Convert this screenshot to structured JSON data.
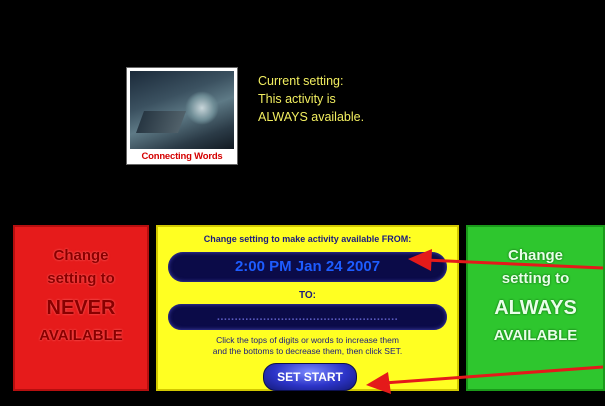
{
  "thumbnail": {
    "label": "Connecting Words"
  },
  "current": {
    "line1": "Current setting:",
    "line2": "This activity is",
    "line3": "ALWAYS available."
  },
  "never_panel": {
    "line1": "Change",
    "line2": "setting to",
    "line3": "NEVER",
    "line4": "AVAILABLE"
  },
  "from_panel": {
    "heading": "Change setting to make activity available FROM:",
    "start_value": "2:00 PM  Jan 24 2007",
    "to_label": "TO:",
    "end_value": "...................................................",
    "instructions_1": "Click the tops of digits or words to increase them",
    "instructions_2": "and the bottoms to decrease them, then click SET.",
    "set_button": "SET START"
  },
  "always_panel": {
    "line1": "Change",
    "line2": "setting to",
    "line3": "ALWAYS",
    "line4": "AVAILABLE"
  },
  "colors": {
    "red_panel": "#e61b1b",
    "yellow_panel": "#ffff22",
    "green_panel": "#2ec62e",
    "arrow": "#e41a1a"
  }
}
